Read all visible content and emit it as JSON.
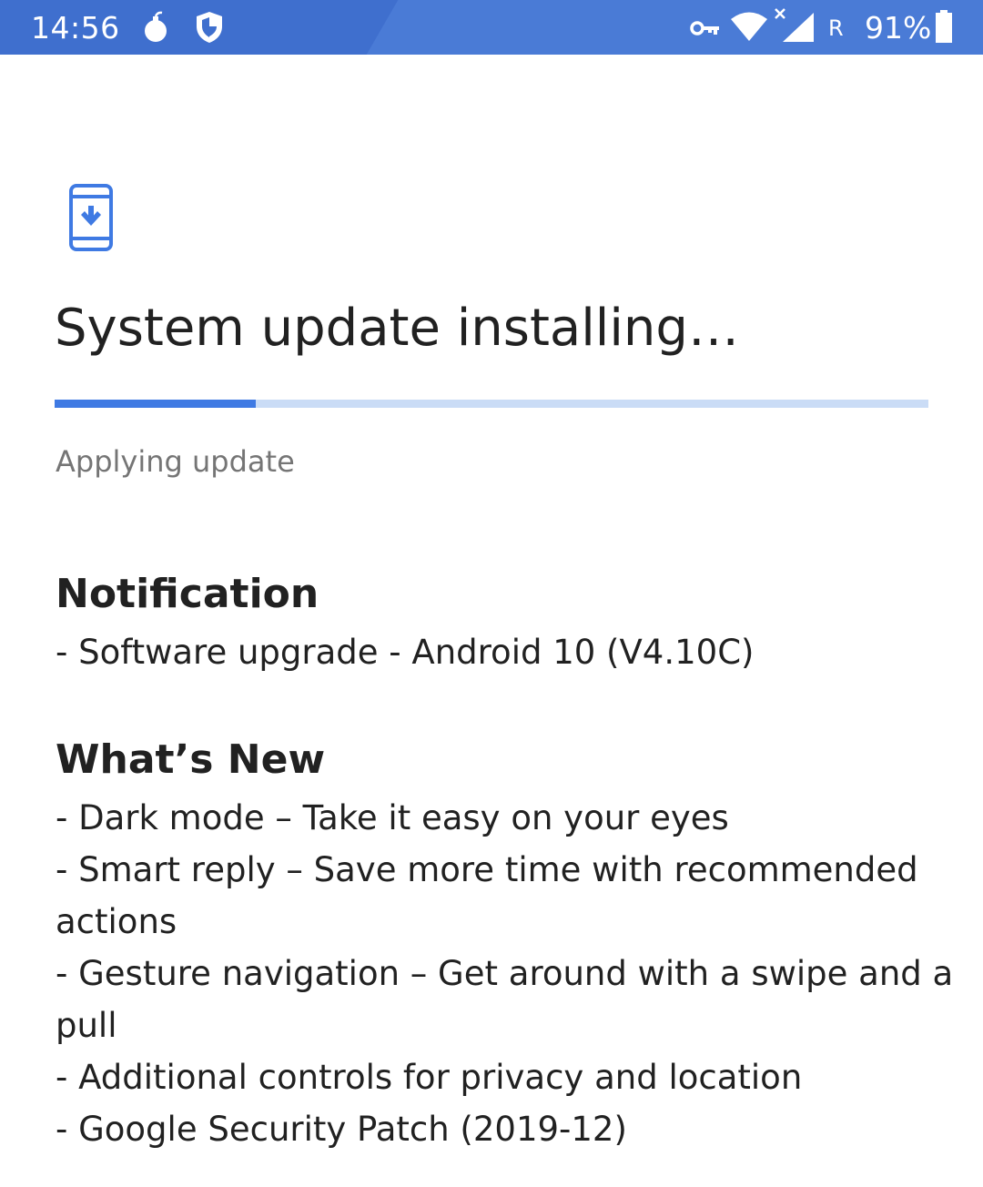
{
  "status_bar": {
    "time": "14:56",
    "roaming": "R",
    "battery": "91%",
    "background_color": "#3f6fce",
    "icons": [
      "notification-bomb-icon",
      "shield-icon",
      "vpn-key-icon",
      "wifi-icon",
      "signal-no-data-icon",
      "battery-icon"
    ]
  },
  "update": {
    "icon": "system-update-phone-icon",
    "title": "System update installing…",
    "progress": 0.23,
    "status": "Applying update",
    "accent_color": "#3f7ae3",
    "track_color": "#cadcf6"
  },
  "notification": {
    "heading": "Notification",
    "lines": [
      "- Software upgrade - Android 10 (V4.10C)"
    ]
  },
  "whats_new": {
    "heading": "What’s New",
    "lines": [
      "- Dark mode – Take it easy on your eyes",
      "- Smart reply – Save more time with recommended",
      "actions",
      "- Gesture navigation – Get around with a swipe and a",
      "pull",
      "- Additional controls for privacy and location",
      "- Google Security Patch (2019-12)"
    ]
  }
}
